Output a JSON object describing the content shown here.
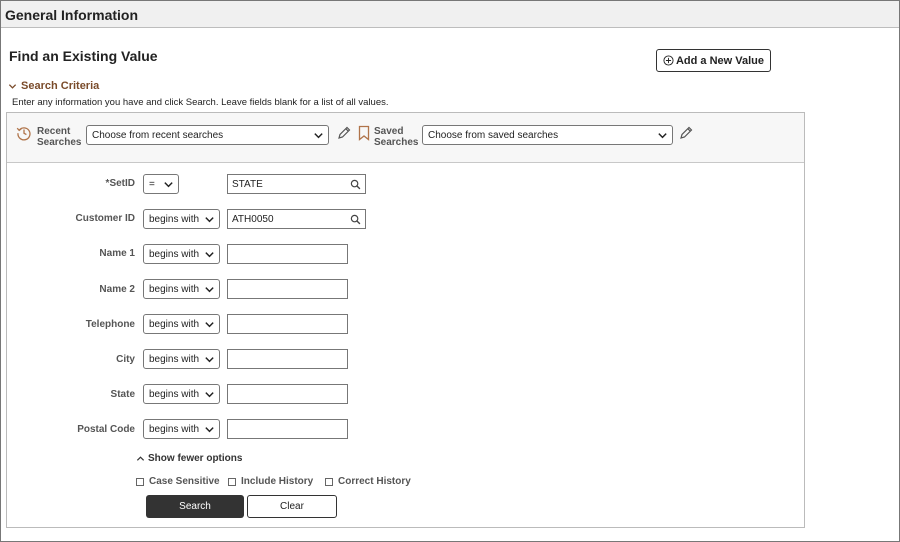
{
  "header": {
    "title": "General Information"
  },
  "page": {
    "title": "Find an Existing Value",
    "add_button_label": "Add a New Value",
    "criteria_label": "Search Criteria",
    "instructions": "Enter any information you have and click Search. Leave fields blank for a list of all values."
  },
  "searches": {
    "recent_label_1": "Recent",
    "recent_label_2": "Searches",
    "recent_placeholder": "Choose from recent searches",
    "saved_label_1": "Saved",
    "saved_label_2": "Searches",
    "saved_placeholder": "Choose from saved searches"
  },
  "fields": [
    {
      "label": "*SetID",
      "operator": "=",
      "value": "STATE"
    },
    {
      "label": "Customer ID",
      "operator": "begins with",
      "value": "ATH0050"
    },
    {
      "label": "Name 1",
      "operator": "begins with",
      "value": ""
    },
    {
      "label": "Name 2",
      "operator": "begins with",
      "value": ""
    },
    {
      "label": "Telephone",
      "operator": "begins with",
      "value": ""
    },
    {
      "label": "City",
      "operator": "begins with",
      "value": ""
    },
    {
      "label": "State",
      "operator": "begins with",
      "value": ""
    },
    {
      "label": "Postal Code",
      "operator": "begins with",
      "value": ""
    }
  ],
  "options": {
    "fewer_label": "Show fewer options",
    "case_sensitive": "Case Sensitive",
    "include_history": "Include History",
    "correct_history": "Correct History"
  },
  "actions": {
    "search": "Search",
    "clear": "Clear"
  },
  "colors": {
    "accent": "#7a4b2a",
    "primary_button": "#333333"
  }
}
